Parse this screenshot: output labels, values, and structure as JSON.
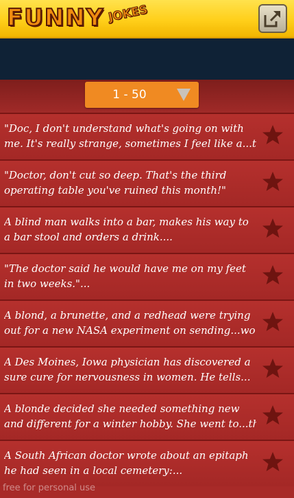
{
  "header": {
    "logo_main": "FUNNY",
    "logo_sub": "JOKES",
    "share_icon": "share-external-icon"
  },
  "range": {
    "label": "1 - 50",
    "arrow_icon": "chevron-down-icon"
  },
  "jokes": [
    {
      "line1": "\"Doc, I don't understand what's going on with",
      "line2": "me. It's really strange, sometimes I feel like a...te",
      "favorite": false
    },
    {
      "line1": "\"Doctor, don't cut so deep. That's the third",
      "line2": "operating table you've ruined this month!\"",
      "favorite": false
    },
    {
      "line1": "A blind man walks into a bar, makes his way to",
      "line2": "a bar stool and orders a drink....",
      "favorite": false
    },
    {
      "line1": "\"The doctor said he would have me on my feet",
      "line2": "in two weeks.\"...",
      "favorite": false
    },
    {
      "line1": "A blond, a brunette, and a redhead were trying",
      "line2": "out for a new NASA experiment on sending...wo",
      "favorite": false
    },
    {
      "line1": "A Des Moines, Iowa physician has discovered a",
      "line2": "sure cure for nervousness in women. He tells...",
      "favorite": false
    },
    {
      "line1": "A blonde decided she needed something new",
      "line2": "and different for a winter hobby. She went to...th",
      "favorite": false
    },
    {
      "line1": "A South African doctor wrote about an epitaph",
      "line2": "he had seen in a local cemetery:...",
      "favorite": false
    }
  ],
  "footer": {
    "note": "free for personal use"
  },
  "colors": {
    "header_yellow": "#ffcf1a",
    "banner_navy": "#0f2236",
    "row_red": "#b5302d",
    "divider": "#7a1614",
    "range_orange": "#f08a22",
    "star": "#6e1410"
  }
}
